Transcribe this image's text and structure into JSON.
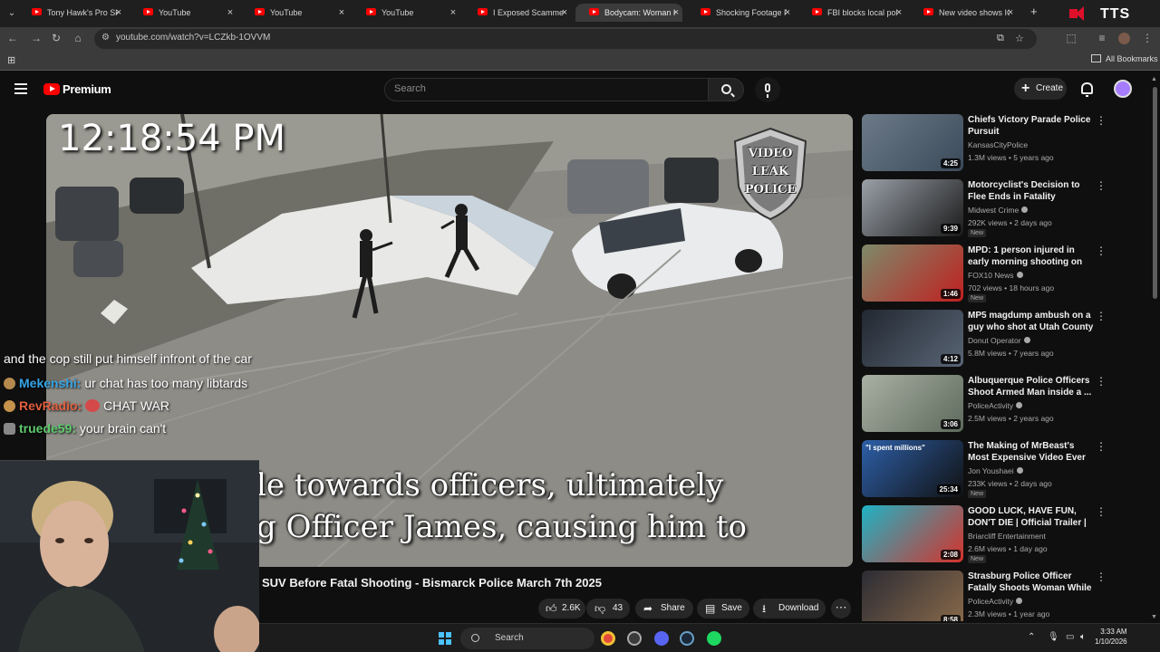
{
  "browser": {
    "tabs": [
      {
        "title": "Tony Hawk's Pro Skat",
        "active": false
      },
      {
        "title": "YouTube",
        "active": false
      },
      {
        "title": "YouTube",
        "active": false
      },
      {
        "title": "YouTube",
        "active": false
      },
      {
        "title": "I Exposed Scammers",
        "active": false
      },
      {
        "title": "Bodycam: Woman H",
        "active": true
      },
      {
        "title": "Shocking Footage Fr",
        "active": false
      },
      {
        "title": "FBI blocks local polic",
        "active": false
      },
      {
        "title": "New video shows ICE",
        "active": false
      }
    ],
    "new_tab_label": "+",
    "url": "youtube.com/watch?v=LCZkb-1OVVM",
    "all_bookmarks": "All Bookmarks",
    "overlay_tts": "TTS"
  },
  "header": {
    "brand": "Premium",
    "search_placeholder": "Search",
    "create_label": "Create"
  },
  "player": {
    "timestamp": "12:18:54 PM",
    "badge_lines": [
      "VIDEO",
      "LEAK",
      "POLICE"
    ],
    "subtitle_line1": "le towards officers, ultimately",
    "subtitle_line2": "g Officer James, causing him to"
  },
  "chat": [
    {
      "user": "",
      "message": "and the cop still put himself infront of the car",
      "color": "#ffffff"
    },
    {
      "user": "Mekenshi:",
      "message": "ur chat has too many libtards",
      "color": "#35a3e4"
    },
    {
      "user": "RevRadio:",
      "message": "CHAT WAR",
      "color": "#e15f3f"
    },
    {
      "user": "truede59:",
      "message": "your brain can't",
      "color": "#5ecb6e"
    }
  ],
  "video": {
    "title": "SUV Before Fatal Shooting - Bismarck Police March 7th 2025",
    "likes": "2.6K",
    "dislikes": "43",
    "share_label": "Share",
    "save_label": "Save",
    "download_label": "Download"
  },
  "recommendations": [
    {
      "title": "Chiefs Victory Parade Police Pursuit",
      "channel": "KansasCityPolice",
      "verified": false,
      "meta": "1.3M views • 5 years ago",
      "duration": "4:25",
      "new": false,
      "colors": [
        "#6c7a88",
        "#3b4a5a"
      ]
    },
    {
      "title": "Motorcyclist's Decision to Flee Ends in Fatality",
      "channel": "Midwest Crime",
      "verified": true,
      "meta": "292K views • 2 days ago",
      "duration": "9:39",
      "new": true,
      "colors": [
        "#9aa0a8",
        "#1a1a1a"
      ]
    },
    {
      "title": "MPD: 1 person injured in early morning shooting on Duval ...",
      "channel": "FOX10 News",
      "verified": true,
      "meta": "702 views • 18 hours ago",
      "duration": "1:46",
      "new": true,
      "colors": [
        "#7e8a6a",
        "#c02020"
      ]
    },
    {
      "title": "MP5 magdump ambush on a guy who shot at Utah County ...",
      "channel": "Donut Operator",
      "verified": true,
      "meta": "5.8M views • 7 years ago",
      "duration": "4:12",
      "new": false,
      "colors": [
        "#222831",
        "#596575"
      ]
    },
    {
      "title": "Albuquerque Police Officers Shoot Armed Man inside a ...",
      "channel": "PoliceActivity",
      "verified": true,
      "meta": "2.5M views • 2 years ago",
      "duration": "3:06",
      "new": false,
      "colors": [
        "#a9b0a4",
        "#5d6a5c"
      ]
    },
    {
      "title": "The Making of MrBeast's Most Expensive Video Ever (Feat. ...",
      "channel": "Jon Youshaei",
      "verified": true,
      "meta": "233K views • 2 days ago",
      "duration": "25:34",
      "new": true,
      "colors": [
        "#2d5fa8",
        "#111111"
      ],
      "thumb_text": "\"I spent millions\""
    },
    {
      "title": "GOOD LUCK, HAVE FUN, DON'T DIE | Official Trailer | February ...",
      "channel": "Briarcliff Entertainment",
      "verified": false,
      "meta": "2.6M views • 1 day ago",
      "duration": "2:08",
      "new": true,
      "colors": [
        "#1fb3c5",
        "#d6322b"
      ]
    },
    {
      "title": "Strasburg Police Officer Fatally Shoots Woman While Being ...",
      "channel": "PoliceActivity",
      "verified": true,
      "meta": "2.3M views • 1 year ago",
      "duration": "8:58",
      "new": false,
      "colors": [
        "#2c2c34",
        "#8a6a4a"
      ]
    }
  ],
  "taskbar": {
    "search_label": "Search",
    "time": "3:33 AM",
    "date": "1/10/2026"
  }
}
